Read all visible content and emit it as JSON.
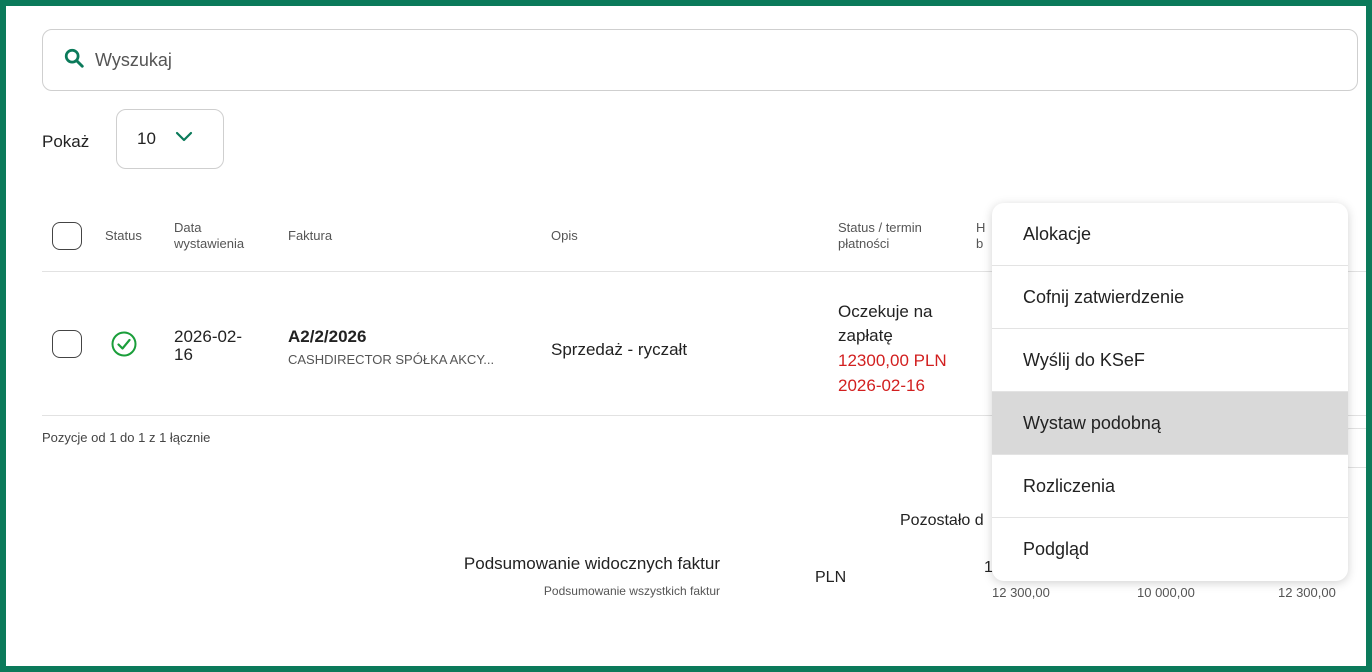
{
  "search": {
    "placeholder": "Wyszukaj",
    "value": ""
  },
  "page_size": {
    "label": "Pokaż",
    "value": "10"
  },
  "table": {
    "headers": {
      "status": "Status",
      "issue_date": "Data\nwystawienia",
      "invoice": "Faktura",
      "description": "Opis",
      "payment_status": "Status / termin\npłatności",
      "hidden_partial": "H\nb"
    },
    "rows": [
      {
        "status_icon": "check-circle-icon",
        "issue_date": "2026-02-\n16",
        "invoice_number": "A2/2/2026",
        "client": "CASHDIRECTOR SPÓŁKA AKCY...",
        "description": "Sprzedaż - ryczałt",
        "payment_state": "Oczekuje na\nzapłatę",
        "amount": "12300,00 PLN",
        "due_date": "2026-02-16"
      }
    ]
  },
  "positions_info": "Pozycje od 1 do 1 z 1 łącznie",
  "summary": {
    "visible_label": "Podsumowanie widocznych faktur",
    "all_label": "Podsumowanie wszystkich faktur",
    "currency": "PLN",
    "remaining_label": "Pozostało d",
    "visible_partial": "1",
    "values": [
      "12 300,00",
      "10 000,00",
      "12 300,00"
    ]
  },
  "context_menu": {
    "items": [
      "Alokacje",
      "Cofnij zatwierdzenie",
      "Wyślij do KSeF",
      "Wystaw podobną",
      "Rozliczenia",
      "Podgląd"
    ],
    "active_index": 3
  },
  "colors": {
    "accent": "#0b7a5a",
    "overdue_red": "#d21f1f",
    "success_green": "#1a9e3a"
  }
}
